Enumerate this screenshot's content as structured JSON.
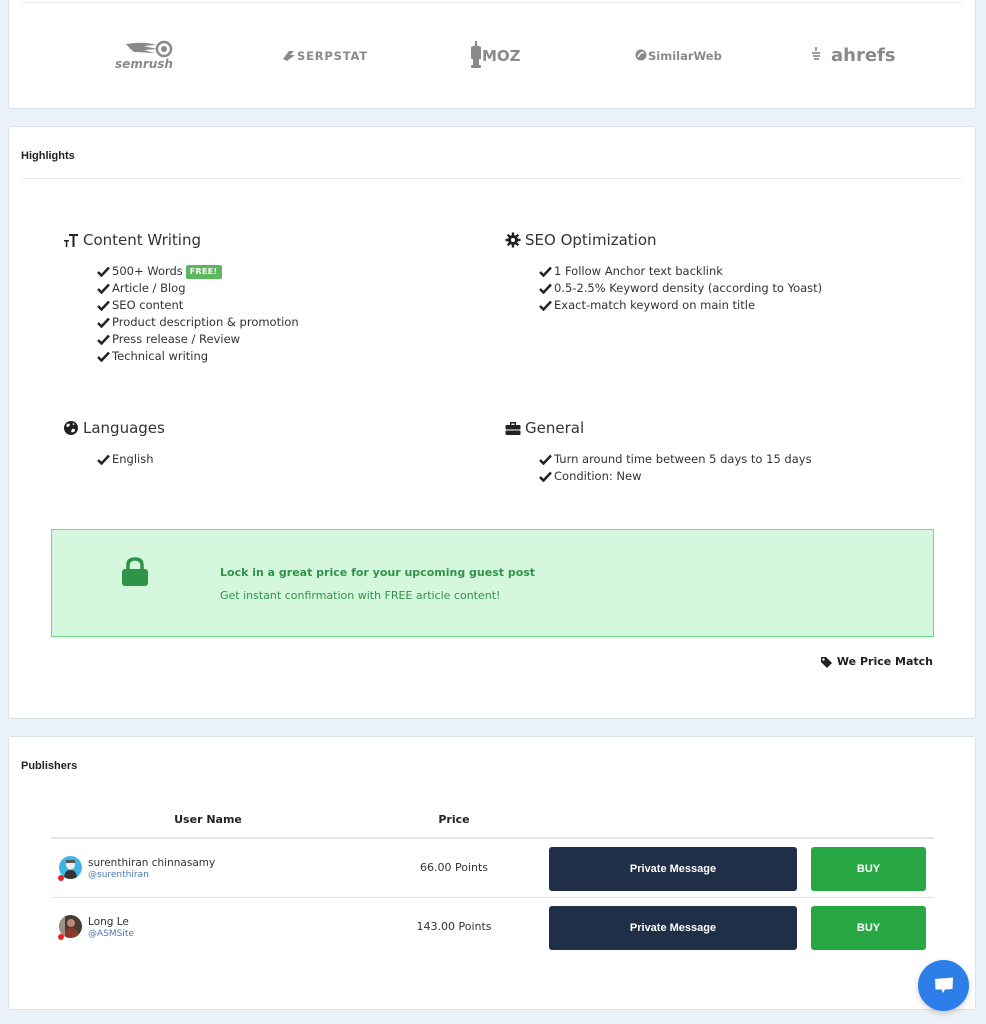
{
  "tools": {
    "logos": [
      {
        "name": "semrush",
        "label": "semrush"
      },
      {
        "name": "serpstat",
        "label": "SERPSTAT"
      },
      {
        "name": "moz",
        "label": "MOZ"
      },
      {
        "name": "similarweb",
        "label": "SimilarWeb"
      },
      {
        "name": "ahrefs",
        "label": "ahrefs"
      }
    ]
  },
  "highlights": {
    "title": "Highlights",
    "groups": {
      "content_writing": {
        "heading": "Content Writing",
        "icon": "text-height-icon",
        "items": [
          "500+ Words",
          "Article / Blog",
          "SEO content",
          "Product description & promotion",
          "Press release / Review",
          "Technical writing"
        ],
        "badge": "FREE!"
      },
      "seo_optimization": {
        "heading": "SEO Optimization",
        "icon": "gear-icon",
        "items": [
          "1 Follow Anchor text backlink",
          "0.5-2.5% Keyword density (according to Yoast)",
          "Exact-match keyword on main title"
        ]
      },
      "languages": {
        "heading": "Languages",
        "icon": "globe-icon",
        "items": [
          "English"
        ]
      },
      "general": {
        "heading": "General",
        "icon": "briefcase-icon",
        "items": [
          "Turn around time between 5 days to 15 days",
          "Condition: New"
        ]
      }
    },
    "promo": {
      "title": "Lock in a great price for your upcoming guest post",
      "subtitle": "Get instant confirmation with FREE article content!"
    },
    "price_match": "We Price Match"
  },
  "publishers": {
    "title": "Publishers",
    "columns": {
      "user_name": "User Name",
      "price": "Price"
    },
    "rows": [
      {
        "name": "surenthiran chinnasamy",
        "handle": "@surenthiran",
        "price": "66.00 Points",
        "pm_label": "Private Message",
        "buy_label": "BUY"
      },
      {
        "name": "Long Le",
        "handle": "@ASMSite",
        "price": "143.00 Points",
        "pm_label": "Private Message",
        "buy_label": "BUY"
      }
    ]
  },
  "colors": {
    "page_bg": "#eaf1f9",
    "promo_bg": "#d5f7de",
    "promo_text": "#2f9448",
    "pm_button": "#1e2f47",
    "buy_button": "#27a844",
    "chat_fab": "#2d7ee8"
  }
}
